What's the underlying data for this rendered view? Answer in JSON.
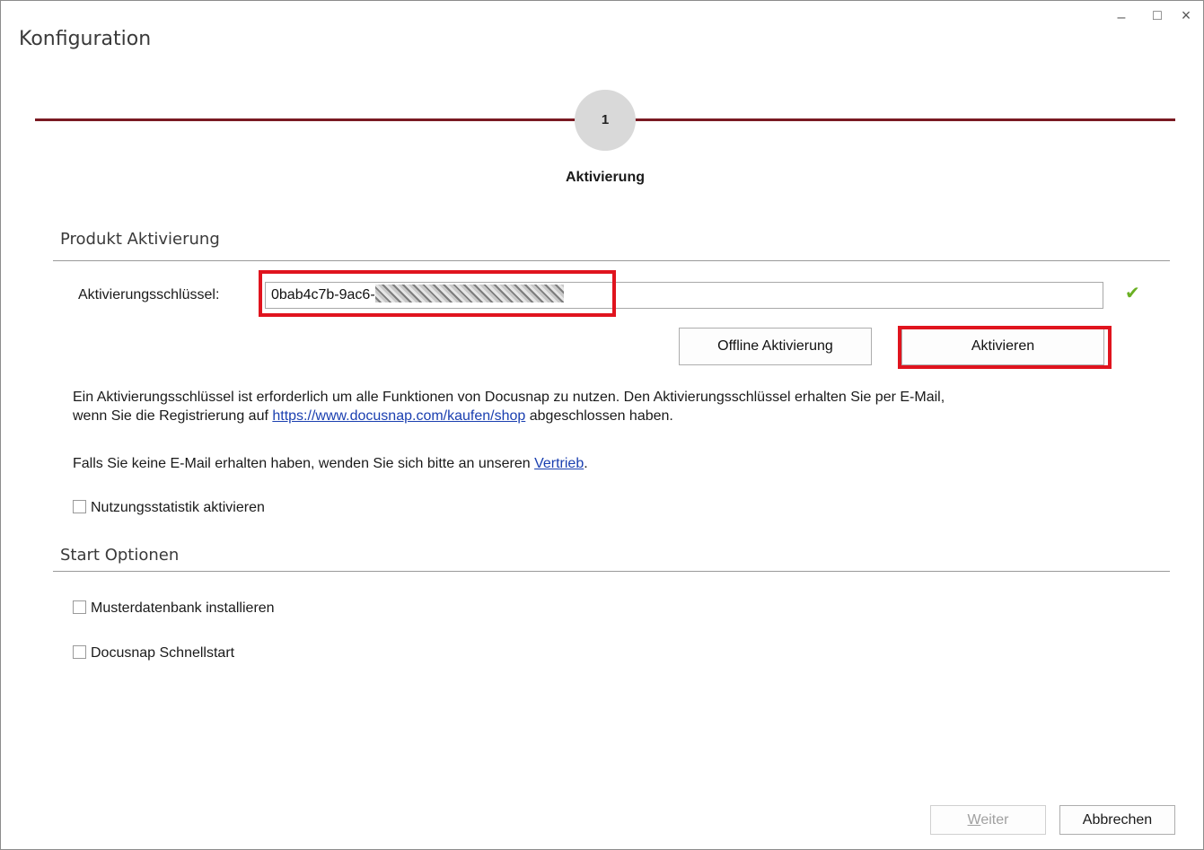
{
  "window": {
    "title": "Konfiguration",
    "controls": {
      "minimize": "–",
      "maximize": "□",
      "close": "×"
    }
  },
  "wizard": {
    "step_number": "1",
    "step_label": "Aktivierung"
  },
  "activation": {
    "section_title": "Produkt Aktivierung",
    "key_label": "Aktivierungsschlüssel:",
    "key_value_visible": "0bab4c7b-9ac6-",
    "key_status_icon": "green-checkmark-icon",
    "offline_button": "Offline Aktivierung",
    "activate_button": "Aktivieren",
    "info_line1": "Ein Aktivierungsschlüssel ist erforderlich um alle Funktionen von Docusnap zu nutzen. Den Aktivierungsschlüssel erhalten Sie per E-Mail,",
    "info_line2_prefix": "wenn Sie die Registrierung auf ",
    "info_link": "https://www.docusnap.com/kaufen/shop",
    "info_line2_suffix": " abgeschlossen haben.",
    "contact_prefix": "Falls Sie keine E-Mail erhalten haben, wenden Sie sich bitte an unseren ",
    "contact_link": "Vertrieb",
    "contact_suffix": ".",
    "stats_checkbox": {
      "label": "Nutzungsstatistik aktivieren",
      "checked": false
    }
  },
  "start_options": {
    "section_title": "Start Optionen",
    "sample_db": {
      "label": "Musterdatenbank installieren",
      "checked": false
    },
    "quickstart": {
      "label": "Docusnap Schnellstart",
      "checked": false
    }
  },
  "footer": {
    "next_button": {
      "label_underlined": "W",
      "label_rest": "eiter",
      "enabled": false
    },
    "cancel_button": "Abbrechen"
  },
  "colors": {
    "accent_line": "#7a1a22",
    "highlight": "#e0141e",
    "link": "#1a3fb0",
    "check": "#6ab023"
  }
}
